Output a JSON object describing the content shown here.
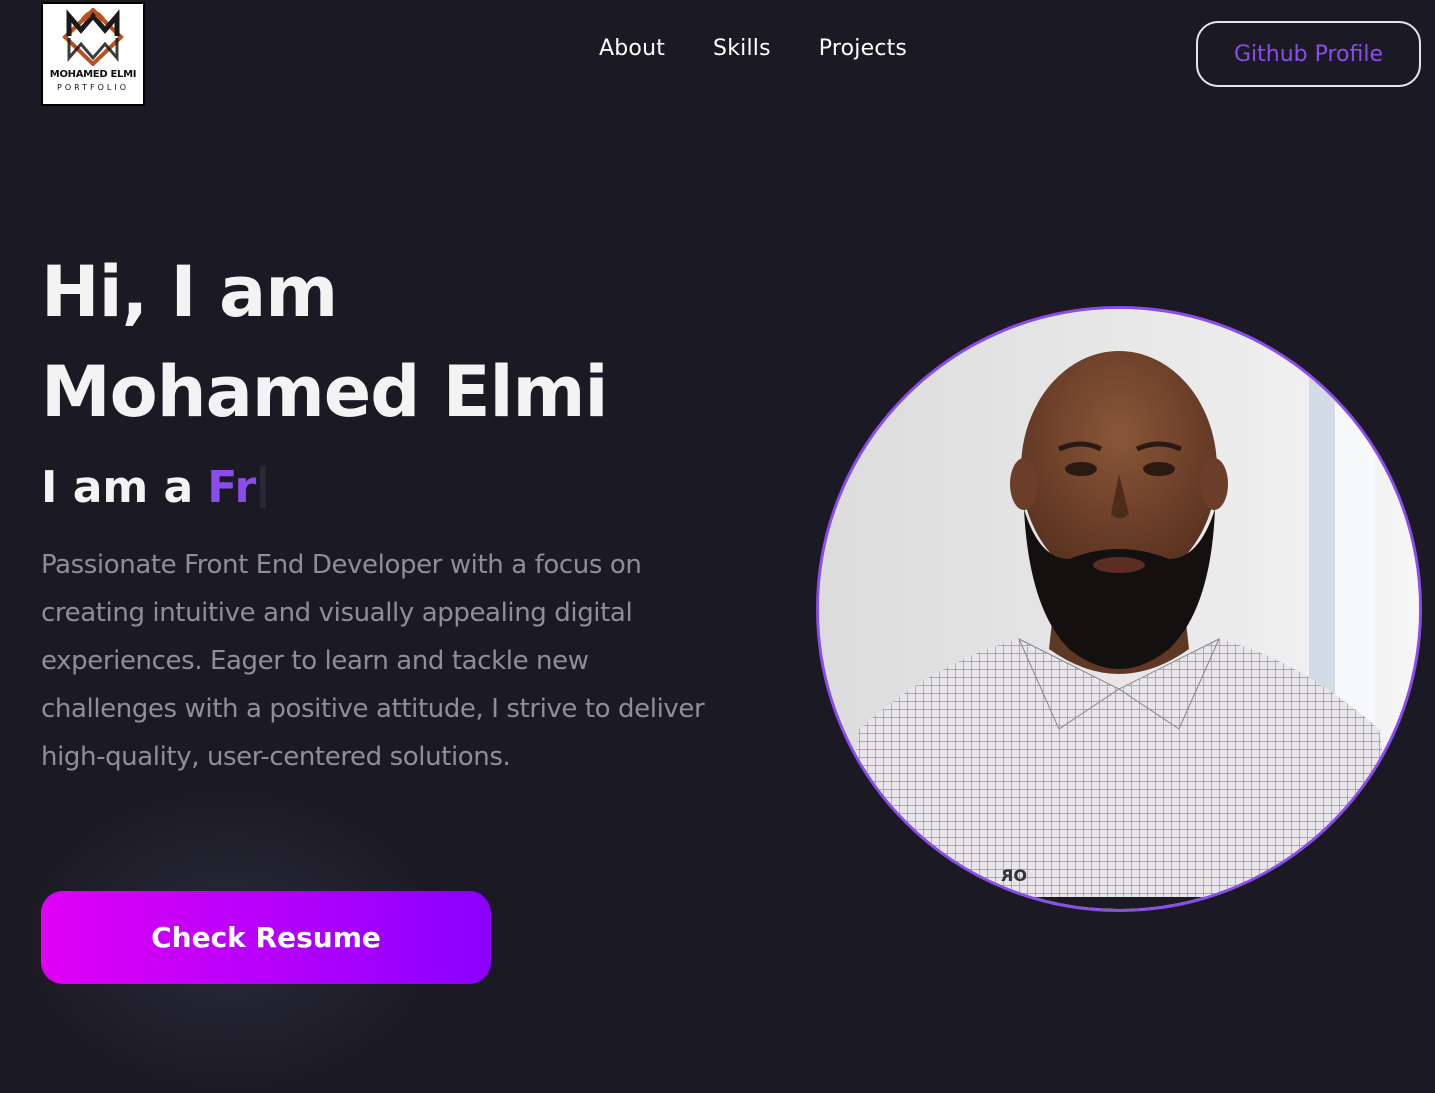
{
  "header": {
    "logo": {
      "name": "MOHAMED ELMI",
      "subtitle": "PORTFOLIO",
      "icon": "mirrored-m-logo-icon"
    },
    "nav": [
      {
        "label": "About"
      },
      {
        "label": "Skills"
      },
      {
        "label": "Projects"
      }
    ],
    "github_button": "Github Profile"
  },
  "hero": {
    "greeting": "Hi, I am",
    "name": "Mohamed Elmi",
    "role_prefix": "I am a",
    "role_typed": "Fr",
    "bio": "Passionate Front End Developer with a focus on creating intuitive and visually appealing digital experiences. Eager to learn and tackle new challenges with a positive attitude, I strive to deliver high-quality, user-centered solutions.",
    "resume_button": "Check Resume",
    "portrait_shirt_text": "OR"
  },
  "colors": {
    "background": "#1b1a24",
    "accent_purple": "#8b4dea",
    "button_gradient_start": "#e100f5",
    "button_gradient_end": "#8a00ff",
    "body_text": "#8e8e9a"
  }
}
